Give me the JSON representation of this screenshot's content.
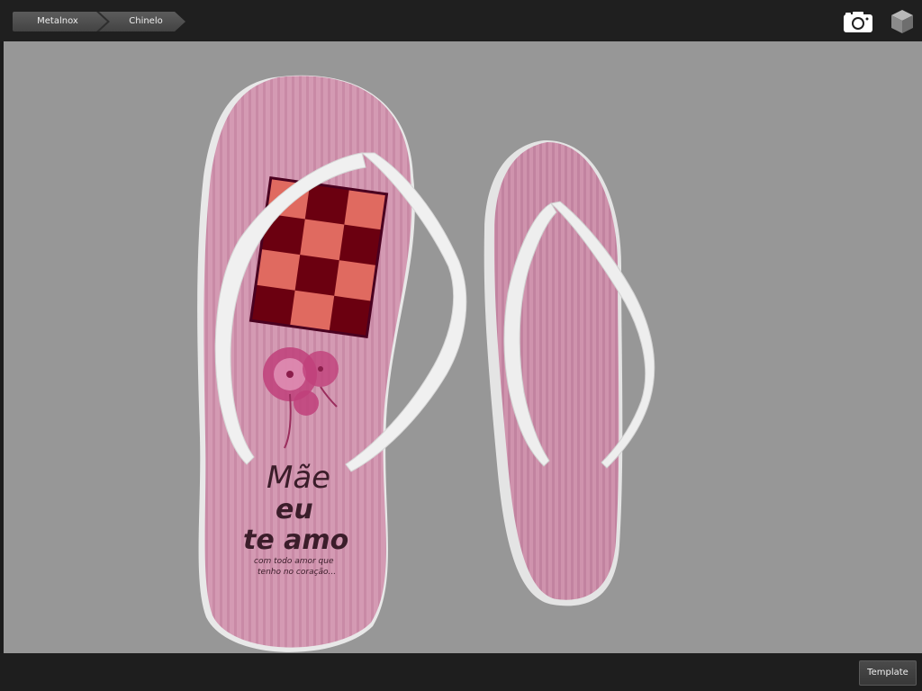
{
  "breadcrumb": {
    "items": [
      {
        "label": "Metalnox"
      },
      {
        "label": "Chinelo"
      }
    ]
  },
  "toolbar": {
    "camera_icon": "camera-icon",
    "cube_icon": "cube-icon"
  },
  "design": {
    "line1": "Mãe",
    "line2": "eu",
    "line3": "te amo",
    "sub1": "com todo amor que",
    "sub2": "tenho no coração..."
  },
  "colors": {
    "viewport_bg": "#979797",
    "sole_pink": "#d69bb5",
    "strap_white": "#f2f2f2",
    "checker_dark": "#6b0010",
    "checker_light": "#e06a60"
  },
  "footer": {
    "template_label": "Template"
  }
}
